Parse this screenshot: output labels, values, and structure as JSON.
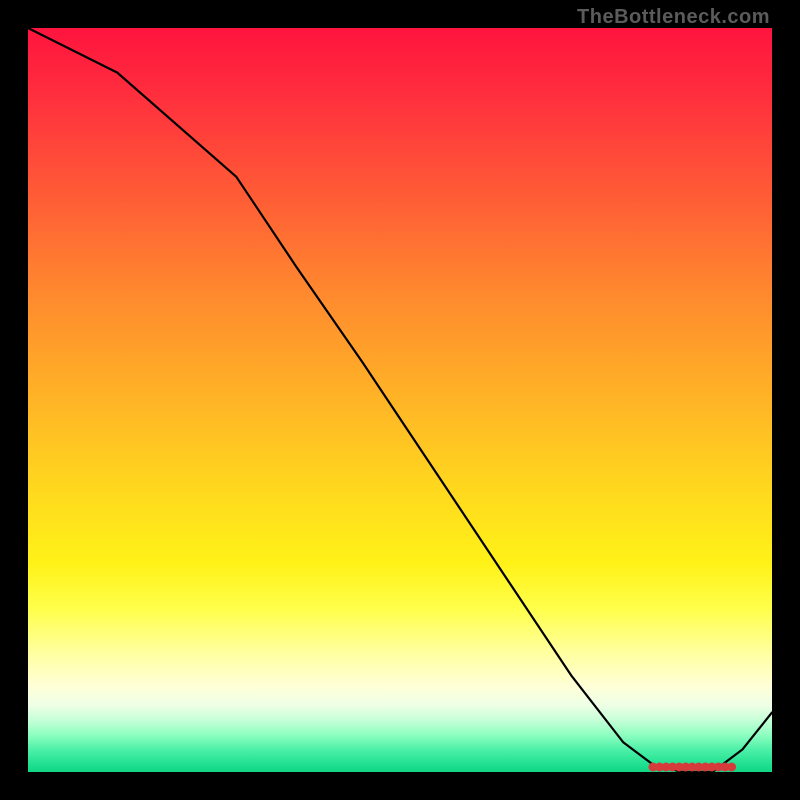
{
  "watermark": "TheBottleneck.com",
  "chart_data": {
    "type": "line",
    "title": "",
    "xlabel": "",
    "ylabel": "",
    "xrange": [
      0,
      100
    ],
    "yrange": [
      0,
      100
    ],
    "x": [
      0,
      12,
      28,
      36,
      45,
      55,
      65,
      73,
      80,
      84,
      88,
      92,
      96,
      100
    ],
    "values": [
      100,
      94,
      80,
      68,
      55,
      40,
      25,
      13,
      4,
      1,
      0,
      0,
      3,
      8
    ],
    "highlight_range": [
      84,
      95
    ],
    "gradient": "red-to-green vertical (red top, green bottom)"
  }
}
